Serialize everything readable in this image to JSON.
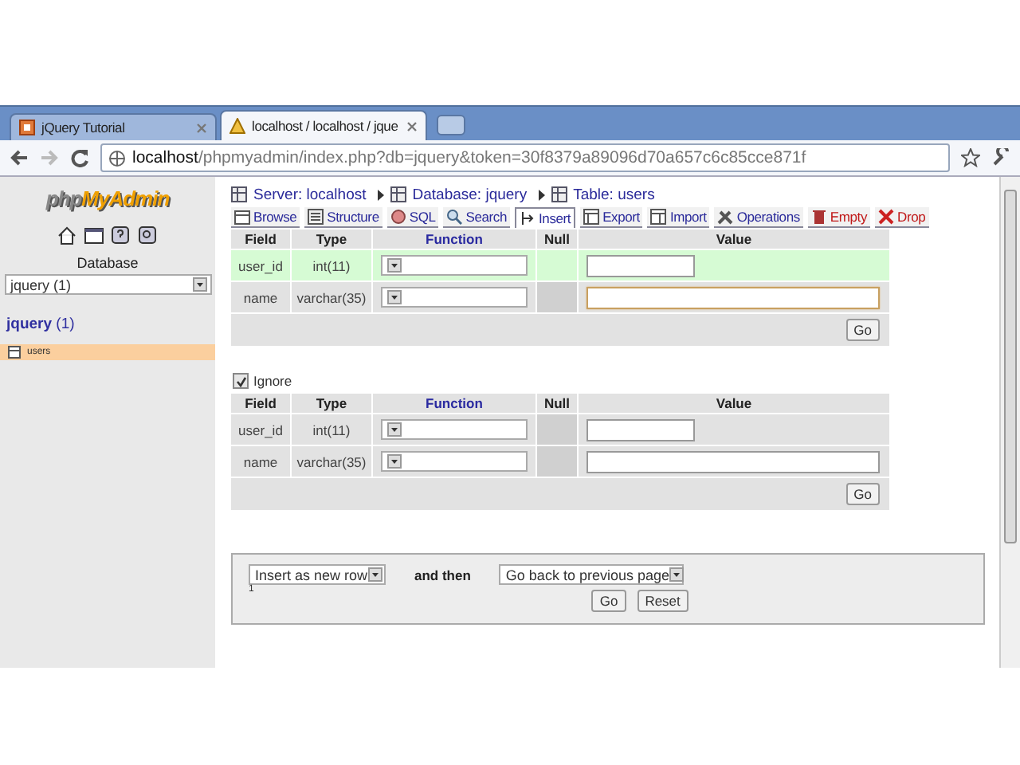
{
  "browser": {
    "tabs": [
      {
        "title": "jQuery Tutorial",
        "selected": false
      },
      {
        "title": "localhost / localhost / jque",
        "selected": true
      }
    ],
    "url_host": "localhost",
    "url_rest": "/phpmyadmin/index.php?db=jquery&token=30f8379a89096d70a657c6c85cce871f"
  },
  "sidebar": {
    "logo_php": "php",
    "logo_rest": "MyAdmin",
    "db_label": "Database",
    "db_select": "jquery (1)",
    "db_name": "jquery",
    "db_count": "(1)",
    "tables": [
      {
        "name": "users",
        "selected": true
      }
    ]
  },
  "breadcrumb": [
    {
      "label": "Server: localhost"
    },
    {
      "label": "Database: jquery"
    },
    {
      "label": "Table: users"
    }
  ],
  "menu": [
    {
      "label": "Browse",
      "kind": "normal",
      "selected": false
    },
    {
      "label": "Structure",
      "kind": "normal",
      "selected": false
    },
    {
      "label": "SQL",
      "kind": "normal",
      "selected": false
    },
    {
      "label": "Search",
      "kind": "normal",
      "selected": false
    },
    {
      "label": "Insert",
      "kind": "normal",
      "selected": true
    },
    {
      "label": "Export",
      "kind": "normal",
      "selected": false
    },
    {
      "label": "Import",
      "kind": "normal",
      "selected": false
    },
    {
      "label": "Operations",
      "kind": "normal",
      "selected": false
    },
    {
      "label": "Empty",
      "kind": "danger",
      "selected": false
    },
    {
      "label": "Drop",
      "kind": "danger",
      "selected": false
    }
  ],
  "forms": [
    {
      "columns": [
        "Field",
        "Type",
        "Function",
        "Null",
        "Value"
      ],
      "rows": [
        {
          "field": "user_id",
          "type": "int(11)",
          "kind": "short",
          "highlighted": true,
          "focused": false
        },
        {
          "field": "name",
          "type": "varchar(35)",
          "kind": "long",
          "highlighted": false,
          "focused": true
        }
      ],
      "button": "Go"
    },
    {
      "ignore": {
        "label": "Ignore",
        "checked": true
      },
      "columns": [
        "Field",
        "Type",
        "Function",
        "Null",
        "Value"
      ],
      "rows": [
        {
          "field": "user_id",
          "type": "int(11)",
          "kind": "short",
          "highlighted": false,
          "focused": false
        },
        {
          "field": "name",
          "type": "varchar(35)",
          "kind": "long",
          "highlighted": false,
          "focused": false
        }
      ],
      "button": "Go"
    }
  ],
  "footer": {
    "mode": "Insert as new row",
    "and_then": "and then",
    "after": "Go back to previous page",
    "note": "1",
    "buttons": [
      "Go",
      "Reset"
    ]
  }
}
